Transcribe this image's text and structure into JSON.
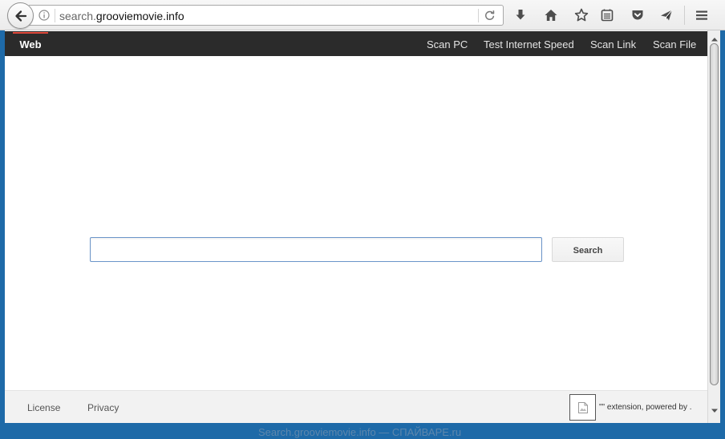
{
  "browser": {
    "url_prefix": "search.",
    "url_host": "grooviemovie.info"
  },
  "nav": {
    "web_label": "Web",
    "links": [
      "Scan PC",
      "Test Internet Speed",
      "Scan Link",
      "Scan File"
    ]
  },
  "search": {
    "value": "",
    "placeholder": "",
    "button_label": "Search"
  },
  "footer": {
    "license_label": "License",
    "privacy_label": "Privacy",
    "extension_text": "\"\" extension, powered by ."
  },
  "watermark": "Search.grooviemovie.info — СПАЙВАРЕ.ru",
  "colors": {
    "nav_bar": "#2b2b2b",
    "nav_active_underline": "#e0493b",
    "search_border": "#6b95c9",
    "desktop": "#1e6aa8"
  },
  "icons": [
    "back-arrow-icon",
    "info-icon",
    "reload-icon",
    "download-icon",
    "home-icon",
    "bookmark-star-icon",
    "reading-list-icon",
    "pocket-icon",
    "send-icon",
    "hamburger-menu-icon",
    "broken-image-icon"
  ]
}
